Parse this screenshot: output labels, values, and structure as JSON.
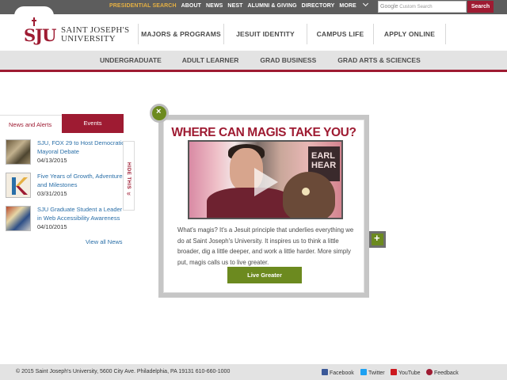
{
  "utility_nav": {
    "items": [
      "PRESIDENTIAL SEARCH",
      "ABOUT",
      "NEWS",
      "NEST",
      "ALUMNI & GIVING",
      "DIRECTORY",
      "MORE"
    ],
    "search_brand": "Google",
    "search_placeholder": "Custom Search",
    "search_button": "Search"
  },
  "brand": {
    "mark": "SJU",
    "name_line1": "SAINT JOSEPH'S",
    "name_line2": "UNIVERSITY"
  },
  "main_nav": [
    "MAJORS & PROGRAMS",
    "JESUIT IDENTITY",
    "CAMPUS LIFE",
    "APPLY ONLINE"
  ],
  "sub_nav": [
    "UNDERGRADUATE",
    "ADULT LEARNER",
    "GRAD BUSINESS",
    "GRAD ARTS & SCIENCES"
  ],
  "news": {
    "tabs": [
      "News and Alerts",
      "Events"
    ],
    "items": [
      {
        "title": "SJU, FOX 29 to Host Democratic Mayoral Debate",
        "date": "04/13/2015"
      },
      {
        "title": "Five Years of Growth, Adventures and Milestones",
        "date": "03/31/2015"
      },
      {
        "title": "SJU Graduate Student a Leader in Web Accessibility Awareness",
        "date": "04/10/2015"
      }
    ],
    "hide_label": "HIDE THIS",
    "hide_arrow": "«",
    "view_all": "View all News"
  },
  "modal": {
    "title": "WHERE CAN MAGIS TAKE YOU?",
    "video_sign": "EARL\nHEAR",
    "body": "What's magis? It's a Jesuit principle that underlies everything we do at Saint Joseph's University. It inspires us to think a little broader, dig a little deeper, and work a little harder. More simply put, magis calls us to live greater.",
    "cta": "Live Greater",
    "close_glyph": "×",
    "expand_glyph": "+"
  },
  "footer": {
    "copyright": "© 2015 Saint Joseph's University, 5600 City Ave. Philadelphia, PA 19131  610-660-1000",
    "social": [
      "Facebook",
      "Twitter",
      "YouTube",
      "Feedback"
    ]
  },
  "colors": {
    "brand_crimson": "#9e1b32",
    "accent_green": "#6c8a1f",
    "highlight_gold": "#e5b043",
    "link_blue": "#2a6fa8"
  }
}
